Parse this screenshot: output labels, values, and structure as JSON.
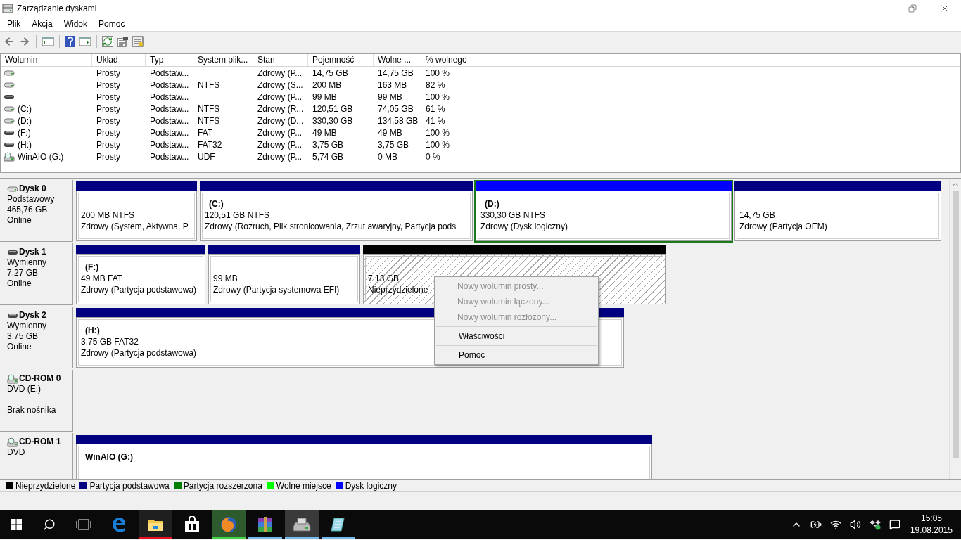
{
  "window": {
    "title": "Zarządzanie dyskami"
  },
  "menu": [
    "Plik",
    "Akcja",
    "Widok",
    "Pomoc"
  ],
  "volumes": {
    "columns": [
      "Wolumin",
      "Układ",
      "Typ",
      "System plik...",
      "Stan",
      "Pojemność",
      "Wolne ...",
      "% wolnego"
    ],
    "rows": [
      {
        "kind": "disk",
        "layout": "Prosty",
        "type": "Podstaw...",
        "status": "Zdrowy (P...",
        "capacity": "14,75 GB",
        "free": "14,75 GB",
        "percent_free": "100 %"
      },
      {
        "kind": "disk",
        "layout": "Prosty",
        "type": "Podstaw...",
        "file_system": "NTFS",
        "status": "Zdrowy (S...",
        "capacity": "200 MB",
        "free": "163 MB",
        "percent_free": "82 %"
      },
      {
        "kind": "removable",
        "layout": "Prosty",
        "type": "Podstaw...",
        "status": "Zdrowy (P...",
        "capacity": "99 MB",
        "free": "99 MB",
        "percent_free": "100 %"
      },
      {
        "kind": "disk",
        "volume": "(C:)",
        "layout": "Prosty",
        "type": "Podstaw...",
        "file_system": "NTFS",
        "status": "Zdrowy (R...",
        "capacity": "120,51 GB",
        "free": "74,05 GB",
        "percent_free": "61 %"
      },
      {
        "kind": "disk",
        "volume": "(D:)",
        "layout": "Prosty",
        "type": "Podstaw...",
        "file_system": "NTFS",
        "status": "Zdrowy (D...",
        "capacity": "330,30 GB",
        "free": "134,58 GB",
        "percent_free": "41 %"
      },
      {
        "kind": "removable",
        "volume": "(F:)",
        "layout": "Prosty",
        "type": "Podstaw...",
        "file_system": "FAT",
        "status": "Zdrowy (P...",
        "capacity": "49 MB",
        "free": "49 MB",
        "percent_free": "100 %"
      },
      {
        "kind": "removable",
        "volume": "(H:)",
        "layout": "Prosty",
        "type": "Podstaw...",
        "file_system": "FAT32",
        "status": "Zdrowy (P...",
        "capacity": "3,75 GB",
        "free": "3,75 GB",
        "percent_free": "100 %"
      },
      {
        "kind": "cdrom",
        "volume": "WinAIO (G:)",
        "layout": "Prosty",
        "type": "Podstaw...",
        "file_system": "UDF",
        "status": "Zdrowy (P...",
        "capacity": "5,74 GB",
        "free": "0 MB",
        "percent_free": "0 %"
      }
    ]
  },
  "disks": [
    {
      "kind": "disk",
      "name": "Dysk 0",
      "type": "Podstawowy",
      "size": "465,76 GB",
      "status": "Online",
      "partitions": [
        {
          "kind": "primary",
          "selected": false,
          "size": "200 MB NTFS",
          "status": "Zdrowy (System, Aktywna, P"
        },
        {
          "kind": "primary",
          "selected": false,
          "label": "(C:)",
          "size": "120,51 GB NTFS",
          "status": "Zdrowy (Rozruch, Plik stronicowania, Zrzut awaryjny, Partycja pods"
        },
        {
          "kind": "logical",
          "selected": true,
          "label": "(D:)",
          "size": "330,30 GB NTFS",
          "status": "Zdrowy (Dysk logiczny)"
        },
        {
          "kind": "primary",
          "selected": false,
          "size": "14,75 GB",
          "status": "Zdrowy (Partycja OEM)"
        }
      ]
    },
    {
      "kind": "removable",
      "name": "Dysk 1",
      "type": "Wymienny",
      "size": "7,27 GB",
      "status": "Online",
      "partitions": [
        {
          "kind": "primary",
          "selected": false,
          "label": "(F:)",
          "size": "49 MB FAT",
          "status": "Zdrowy (Partycja podstawowa)"
        },
        {
          "kind": "primary",
          "selected": false,
          "size": "99 MB",
          "status": "Zdrowy (Partycja systemowa EFI)"
        },
        {
          "kind": "unallocated",
          "selected": false,
          "size": "7,13 GB",
          "status": "Nieprzydzielone"
        }
      ]
    },
    {
      "kind": "removable",
      "name": "Dysk 2",
      "type": "Wymienny",
      "size": "3,75 GB",
      "status": "Online",
      "partitions": [
        {
          "kind": "primary",
          "selected": false,
          "label": "(H:)",
          "size": "3,75 GB FAT32",
          "status": "Zdrowy (Partycja podstawowa)"
        }
      ]
    },
    {
      "kind": "cdrom",
      "name": "CD-ROM 0",
      "type": "DVD (E:)",
      "status": "Brak nośnika"
    },
    {
      "kind": "cdrom",
      "name": "CD-ROM 1",
      "type": "DVD",
      "partitions": [
        {
          "kind": "primary",
          "selected": false,
          "label": "WinAIO (G:)"
        }
      ]
    }
  ],
  "context_menu": [
    [
      {
        "label": "Nowy wolumin prosty...",
        "disabled": true
      },
      {
        "label": "Nowy wolumin łączony...",
        "disabled": true
      },
      {
        "label": "Nowy wolumin rozłożony...",
        "disabled": true
      }
    ],
    [
      {
        "label": "Właściwości",
        "disabled": false
      }
    ],
    [
      {
        "label": "Pomoc",
        "disabled": false
      }
    ]
  ],
  "legend": [
    {
      "label": "Nieprzydzielone",
      "color": "#000000"
    },
    {
      "label": "Partycja podstawowa",
      "color": "#000080"
    },
    {
      "label": "Partycja rozszerzona",
      "color": "#008000"
    },
    {
      "label": "Wolne miejsce",
      "color": "#00ff00"
    },
    {
      "label": "Dysk logiczny",
      "color": "#0000ff"
    }
  ],
  "taskbar": {
    "apps": [
      {
        "kind": "edge",
        "running": false,
        "selected": false
      },
      {
        "kind": "explorer",
        "running": true,
        "selected": false
      },
      {
        "kind": "store",
        "running": false,
        "selected": false
      },
      {
        "kind": "firefox",
        "running": true,
        "selected": false
      },
      {
        "kind": "winrar",
        "running": true,
        "selected": false
      },
      {
        "kind": "diskmgmt",
        "running": true,
        "selected": true
      },
      {
        "kind": "notepad",
        "running": true,
        "selected": false
      }
    ],
    "time": "15:05",
    "date": "19.08.2015"
  }
}
